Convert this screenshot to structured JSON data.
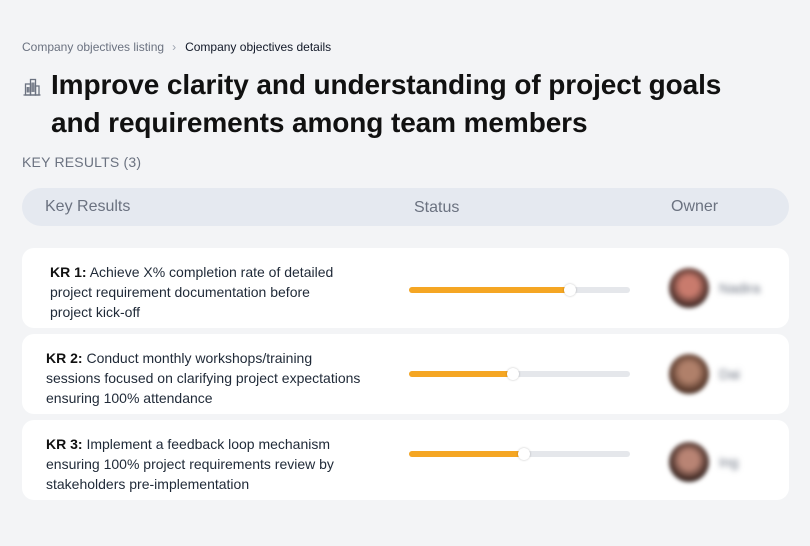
{
  "breadcrumb": {
    "parent": "Company objectives listing",
    "separator": "›",
    "current": "Company objectives details"
  },
  "objective": {
    "icon": "building-icon",
    "title": "Improve clarity and understanding of project goals and requirements among team members"
  },
  "key_results_heading": "KEY RESULTS (3)",
  "table": {
    "columns": {
      "key_results": "Key Results",
      "status": "Status",
      "owner": "Owner"
    }
  },
  "key_results": [
    {
      "code": "KR 1:",
      "text": "Achieve X% completion rate of detailed project requirement documentation before project kick-off",
      "progress": 0.73,
      "owner": "Nadira",
      "avatar_colors": [
        "#3a2420",
        "#c97b6d"
      ]
    },
    {
      "code": "KR 2:",
      "text": "Conduct monthly workshops/training sessions focused on clarifying project expectations ensuring 100% attendance",
      "progress": 0.47,
      "owner": "Dai",
      "avatar_colors": [
        "#4a2e22",
        "#b0806a"
      ]
    },
    {
      "code": "KR 3:",
      "text": "Implement a feedback loop mechanism ensuring 100% project requirements review by stakeholders pre-implementation",
      "progress": 0.52,
      "owner": "Ing",
      "avatar_colors": [
        "#2e1c18",
        "#b98474"
      ]
    }
  ],
  "colors": {
    "accent": "#f5a623",
    "track": "#e5e7eb",
    "header_bg": "#e5e9f0",
    "page_bg": "#f3f4f6"
  }
}
